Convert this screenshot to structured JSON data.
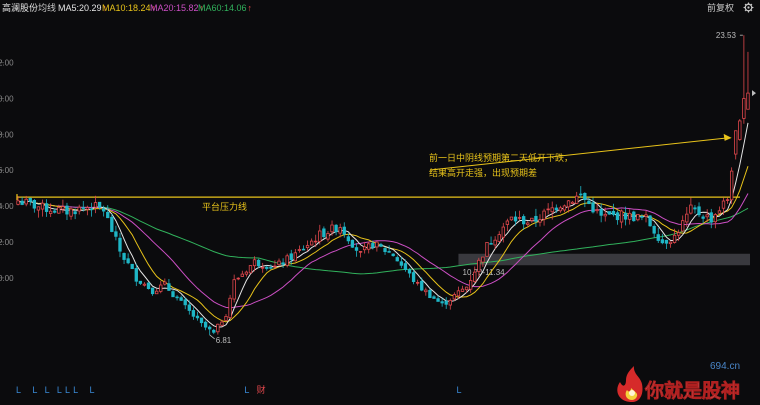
{
  "header": {
    "stock_name": "高澜股份",
    "mode": "均线",
    "ma5": {
      "label": "MA5:20.29",
      "color": "#e6e6e6"
    },
    "ma10": {
      "label": "MA10:18.24",
      "color": "#e8c31a"
    },
    "ma20": {
      "label": "MA20:15.82",
      "color": "#cc4fc4"
    },
    "ma60": {
      "label": "MA60:14.06",
      "color": "#31b25c"
    },
    "adjust_button": "前复权",
    "settings_icon": "gear-icon"
  },
  "watermark": {
    "site": "694.cn",
    "slogan": "你就是股神",
    "logo_icon": "flame-logo-icon"
  },
  "chart_data": {
    "type": "candlestick",
    "title": "",
    "xlabel": "",
    "ylabel": "",
    "ylim": [
      4.3,
      24.6
    ],
    "y_ticks": [
      22,
      20,
      18,
      16,
      14,
      12,
      10
    ],
    "y_tick_labels": [
      "2.00",
      "0.00",
      "8.00",
      "6.00",
      "4.00",
      "2.00",
      "0.00"
    ],
    "grid": false,
    "candle_count": 180,
    "up_color": "#e0474c",
    "down_color": "#1fb6c6",
    "resistance_line": {
      "price": 14.5,
      "label": "平台压力线",
      "color": "#e8c31a"
    },
    "support_zone": {
      "low": 10.7,
      "high": 11.34,
      "label": "10.70-11.34"
    },
    "annotations": [
      {
        "label": "23.53",
        "price": 23.53,
        "kind": "high"
      },
      {
        "label": "6.81",
        "price": 6.81,
        "kind": "low"
      },
      {
        "lines": [
          "前一日中阴线预期第二天低开下跌，",
          "结果高开走强，出现预期差"
        ],
        "target_price": 17.8,
        "color": "#e8c31a"
      }
    ],
    "markers": [
      {
        "idx": 0,
        "text": "L"
      },
      {
        "idx": 4,
        "text": "L"
      },
      {
        "idx": 7,
        "text": "L"
      },
      {
        "idx": 10,
        "text": "L"
      },
      {
        "idx": 12,
        "text": "L"
      },
      {
        "idx": 14,
        "text": "L"
      },
      {
        "idx": 18,
        "text": "L"
      },
      {
        "idx": 56,
        "text": "L"
      },
      {
        "idx": 59,
        "text": "财"
      },
      {
        "idx": 108,
        "text": "L"
      }
    ],
    "ma_lines": [
      "MA5",
      "MA10",
      "MA20",
      "MA60"
    ],
    "keypoints": [
      [
        0,
        14.3
      ],
      [
        6,
        13.9
      ],
      [
        12,
        13.7
      ],
      [
        18,
        14.0
      ],
      [
        21,
        13.8
      ],
      [
        25,
        11.5
      ],
      [
        29,
        10.0
      ],
      [
        33,
        9.3
      ],
      [
        36,
        9.6
      ],
      [
        40,
        8.6
      ],
      [
        45,
        7.4
      ],
      [
        48,
        6.9
      ],
      [
        51,
        8.0
      ],
      [
        53,
        9.8
      ],
      [
        58,
        10.9
      ],
      [
        63,
        10.6
      ],
      [
        68,
        11.3
      ],
      [
        74,
        12.4
      ],
      [
        79,
        12.9
      ],
      [
        84,
        11.3
      ],
      [
        87,
        11.9
      ],
      [
        92,
        11.3
      ],
      [
        98,
        9.6
      ],
      [
        104,
        8.5
      ],
      [
        110,
        9.5
      ],
      [
        115,
        11.8
      ],
      [
        118,
        12.6
      ],
      [
        121,
        13.3
      ],
      [
        126,
        13.1
      ],
      [
        132,
        14.0
      ],
      [
        138,
        14.6
      ],
      [
        143,
        13.4
      ],
      [
        148,
        13.5
      ],
      [
        154,
        13.3
      ],
      [
        158,
        12.0
      ],
      [
        161,
        12.3
      ],
      [
        165,
        13.8
      ],
      [
        170,
        13.3
      ],
      [
        174,
        14.4
      ],
      [
        176,
        17.5
      ],
      [
        178,
        20.0
      ],
      [
        179,
        20.3
      ]
    ]
  }
}
